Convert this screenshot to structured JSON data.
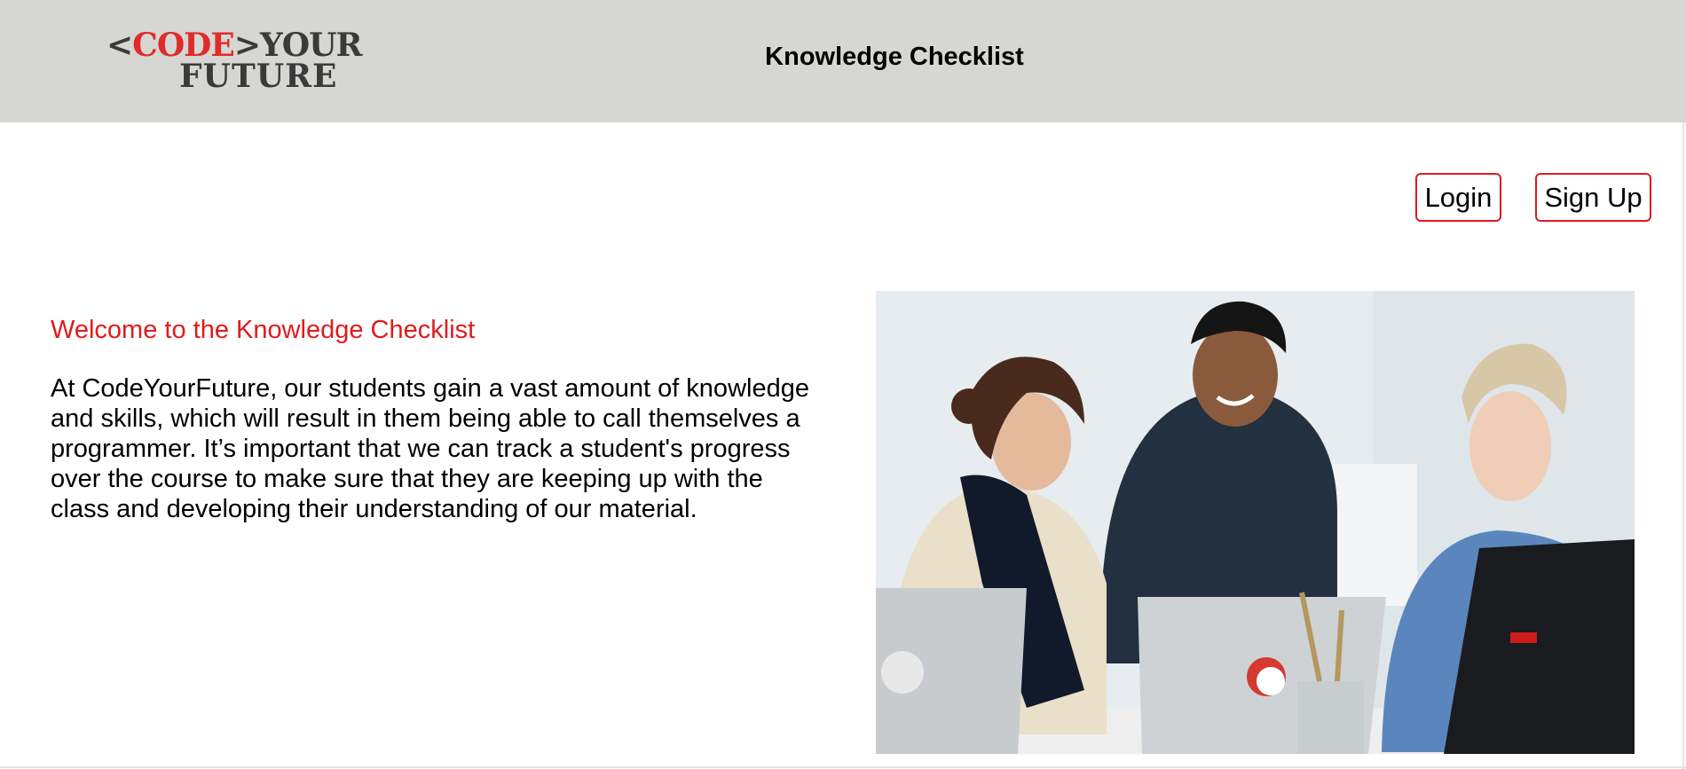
{
  "header": {
    "logo": {
      "open_bracket": "<",
      "code": "CODE",
      "close_bracket": ">",
      "your": "YOUR",
      "future": "FUTURE"
    },
    "title": "Knowledge Checklist"
  },
  "auth": {
    "login_label": "Login",
    "signup_label": "Sign Up"
  },
  "main": {
    "welcome_heading": "Welcome to the Knowledge Checklist",
    "intro_text": "At CodeYourFuture, our students gain a vast amount of knowledge and skills, which will result in them being able to call themselves a programmer. It’s important that we can track a student's progress over the course to make sure that they are keeping up with the class and developing their understanding of our material."
  },
  "colors": {
    "header_bg": "#d6d6d2",
    "accent_red": "#e01b1b",
    "logo_dark": "#3a3a3a"
  }
}
